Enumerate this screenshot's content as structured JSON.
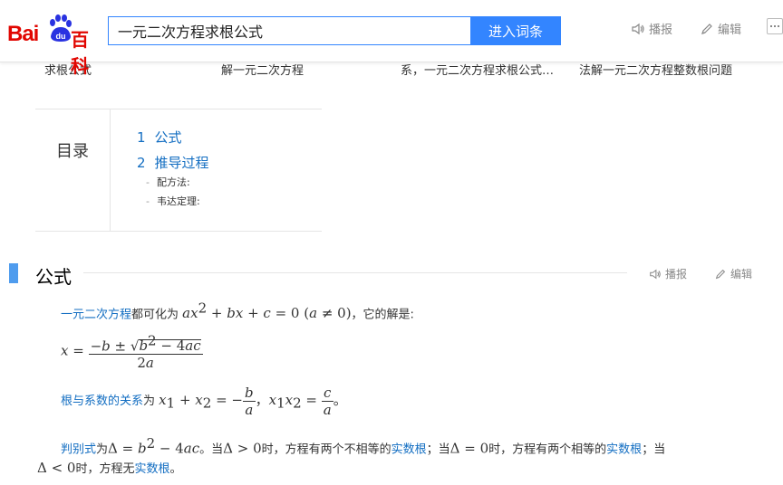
{
  "header": {
    "logo": {
      "text_bai": "Bai",
      "text_du": "du",
      "text_baike": "百科"
    },
    "search": {
      "value": "一元二次方程求根公式",
      "button_label": "进入词条"
    },
    "actions": {
      "report_label": "播报",
      "edit_label": "编辑"
    }
  },
  "related": [
    "求根公式",
    "解一元二次方程",
    "系，一元二次方程求根公式…",
    "法解一元二次方程整数根问题"
  ],
  "toc": {
    "title": "目录",
    "items": [
      {
        "num": "1",
        "label": "公式"
      },
      {
        "num": "2",
        "label": "推导过程"
      }
    ],
    "subitems": [
      "配方法:",
      "韦达定理:"
    ]
  },
  "section": {
    "title": "公式",
    "report_label": "播报",
    "edit_label": "编辑"
  },
  "content": {
    "p1_link": "一元二次方程",
    "p1_text": "都可化为",
    "p1_tail": "，它的解是:",
    "p3_link": "根与系数的关系",
    "p3_text": "为",
    "p4_link1": "判别式",
    "p4_text1": "为",
    "p4_text2": "。当",
    "p4_text3": "时，方程有两个不相等的",
    "p4_link2": "实数根",
    "p4_text4": "；当",
    "p4_text5": "时，方程有两个相等的",
    "p4_link3": "实数根",
    "p4_text6": "；当",
    "p5_text1": "时，方程无",
    "p5_link": "实数根",
    "p5_end": "。"
  },
  "colors": {
    "brand_red": "#e10601",
    "accent_blue": "#3385ff",
    "link_blue": "#136ec2",
    "section_bar": "#4f9cee"
  }
}
